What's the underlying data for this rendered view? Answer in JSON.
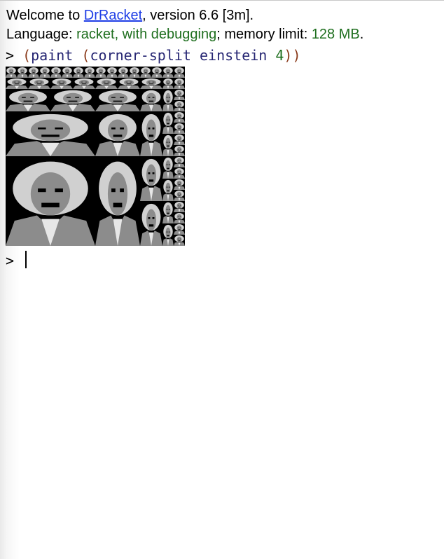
{
  "welcome": {
    "prefix": "Welcome to ",
    "link": "DrRacket",
    "suffix": ", version 6.6 [3m]."
  },
  "language": {
    "label": "Language: ",
    "value": "racket, with debugging",
    "sep": "; memory limit: ",
    "memory": "128 MB",
    "end": "."
  },
  "repl": {
    "prompt": ">",
    "open1": "(",
    "fn": "paint",
    "open2": "(",
    "proc": "corner-split",
    "arg": "einstein",
    "num": "4",
    "close": "))",
    "next_prompt": ">"
  },
  "image": {
    "icon": "einstein-corner-split-image",
    "colors": {
      "dark": "#000000",
      "light": "#e7e7e7",
      "mid": "#8c8c8c"
    }
  }
}
